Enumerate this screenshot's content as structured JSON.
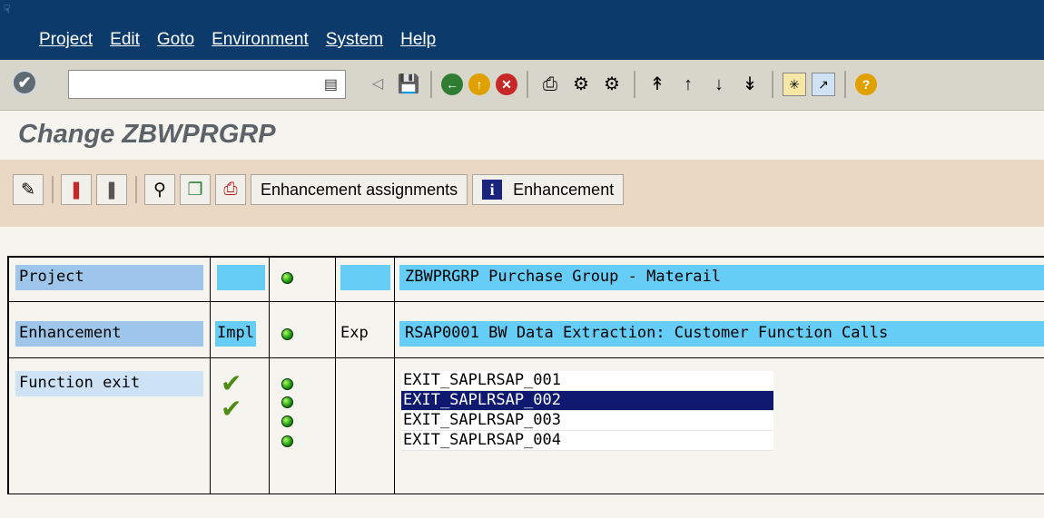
{
  "menu": {
    "items": [
      {
        "label": "Project"
      },
      {
        "label": "Edit"
      },
      {
        "label": "Goto"
      },
      {
        "label": "Environment"
      },
      {
        "label": "System"
      },
      {
        "label": "Help"
      }
    ]
  },
  "toolbar": {
    "command_field": {
      "value": "",
      "placeholder": ""
    }
  },
  "title": "Change ZBWPRGRP",
  "app_toolbar": {
    "enh_assignments_label": "Enhancement assignments",
    "enhancement_label": "Enhancement"
  },
  "table": {
    "project": {
      "label": "Project",
      "description": "ZBWPRGRP Purchase Group - Materail"
    },
    "enhancement": {
      "label": "Enhancement",
      "impl": "Impl",
      "exp": "Exp",
      "description": "RSAP0001 BW Data Extraction: Customer Function Calls"
    },
    "function_exit": {
      "label": "Function exit",
      "exits": [
        {
          "name": "EXIT_SAPLRSAP_001",
          "implemented": true,
          "selected": false
        },
        {
          "name": "EXIT_SAPLRSAP_002",
          "implemented": true,
          "selected": true
        },
        {
          "name": "EXIT_SAPLRSAP_003",
          "implemented": false,
          "selected": false
        },
        {
          "name": "EXIT_SAPLRSAP_004",
          "implemented": false,
          "selected": false
        }
      ]
    }
  },
  "colors": {
    "menubar": "#0b3a6b",
    "toolbar": "#d8d6cb",
    "app_toolbar": "#ead8c5",
    "label_blue": "#9ec6ea",
    "cyan": "#66cdf7",
    "selected_row": "#0f1970",
    "status_green": "#229911"
  }
}
